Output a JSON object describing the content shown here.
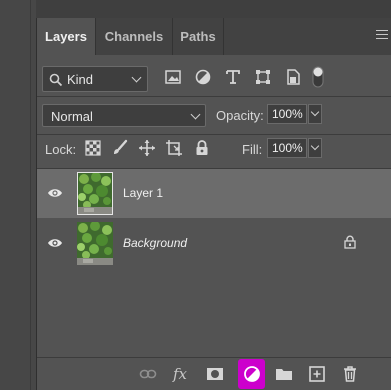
{
  "tabs": [
    {
      "label": "Layers",
      "active": true
    },
    {
      "label": "Channels",
      "active": false
    },
    {
      "label": "Paths",
      "active": false
    }
  ],
  "filter": {
    "kind_label": "Kind",
    "icons": [
      "pixel-filter-icon",
      "adjustment-filter-icon",
      "type-filter-icon",
      "shape-filter-icon",
      "smartobject-filter-icon",
      "filter-toggle-icon"
    ]
  },
  "blend": {
    "mode": "Normal",
    "opacity_label": "Opacity:",
    "opacity_value": "100%"
  },
  "lock": {
    "label": "Lock:",
    "fill_label": "Fill:",
    "fill_value": "100%"
  },
  "layers": [
    {
      "name": "Layer 1",
      "selected": true,
      "locked": false,
      "italic": false
    },
    {
      "name": "Background",
      "selected": false,
      "locked": true,
      "italic": true
    }
  ],
  "bottom_icons": [
    "link-layers-icon",
    "fx-icon",
    "mask-icon",
    "adjustment-layer-icon",
    "group-folder-icon",
    "new-layer-icon",
    "trash-icon"
  ],
  "bottom": {
    "fx_label": "fx"
  },
  "colors": {
    "panel": "#535353",
    "tabbar": "#424242",
    "selected_row": "#6c6c6c",
    "highlight": "#cc00cc"
  }
}
